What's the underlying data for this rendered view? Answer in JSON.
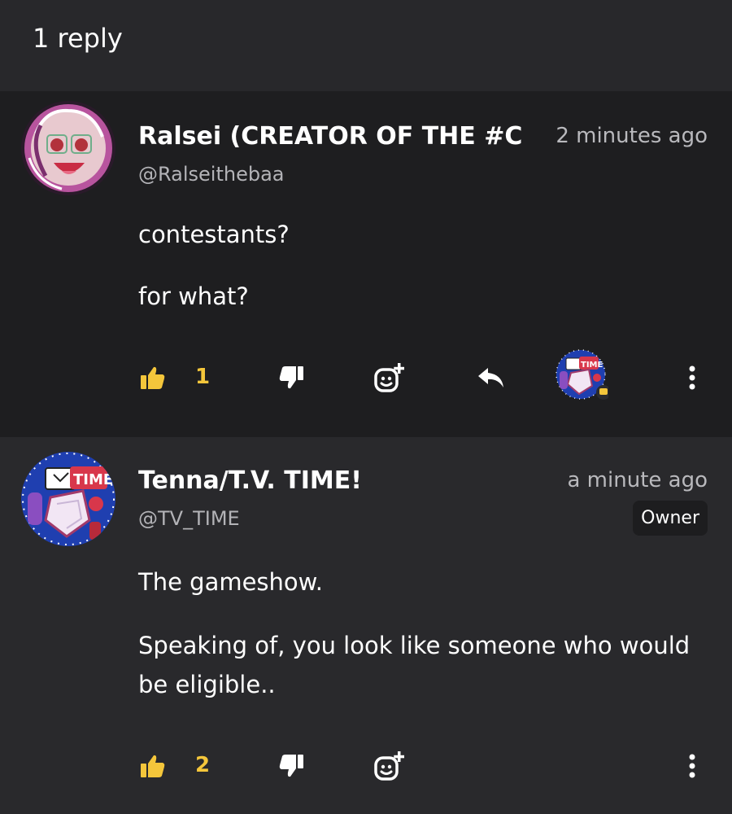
{
  "header": {
    "title": "1 reply"
  },
  "comments": [
    {
      "author": "Ralsei (CREATOR OF THE #C",
      "handle": "@Ralseithebaa",
      "time": "2 minutes ago",
      "paragraphs": [
        "contestants?",
        "for what?"
      ],
      "likes": "1",
      "has_reply_button": true,
      "avatar_icon": "ralsei-avatar",
      "reactor_icon": "tenna-avatar"
    },
    {
      "author": "Tenna/T.V. TIME!",
      "handle": "@TV_TIME",
      "time": "a minute ago",
      "badge": "Owner",
      "paragraphs": [
        "The gameshow.",
        "Speaking of, you look like someone who would be eligible.."
      ],
      "likes": "2",
      "avatar_icon": "tenna-avatar"
    }
  ],
  "colors": {
    "accent": "#f4c63b",
    "background": "#1e1e20",
    "header": "#28282b",
    "alt_comment": "#29292c"
  },
  "icons": [
    "thumbs-up-icon",
    "thumbs-down-icon",
    "add-reaction-icon",
    "reply-arrow-icon",
    "more-vertical-icon"
  ]
}
